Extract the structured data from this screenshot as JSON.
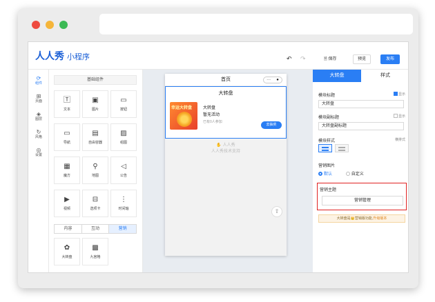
{
  "window": {
    "colors": {
      "close": "#ee4a3f",
      "minimize": "#f5b53a",
      "zoom": "#3cba55",
      "accent": "#2a7ef4",
      "highlight": "#e02020"
    }
  },
  "header": {
    "logo": "人人秀",
    "subtitle": "小程序",
    "save": "保存",
    "preview": "预览",
    "publish": "发布"
  },
  "leftnav": [
    {
      "icon": "component-icon",
      "label": "组件"
    },
    {
      "icon": "page-icon",
      "label": "页面"
    },
    {
      "icon": "layer-icon",
      "label": "图层"
    },
    {
      "icon": "style-icon",
      "label": "风格"
    },
    {
      "icon": "settings-icon",
      "label": "设置"
    }
  ],
  "components": {
    "section_title": "基础组件",
    "basic": [
      {
        "icon": "text-icon",
        "label": "文本"
      },
      {
        "icon": "image-icon",
        "label": "图片"
      },
      {
        "icon": "button-icon",
        "label": "按钮"
      },
      {
        "icon": "nav-icon",
        "label": "导航"
      },
      {
        "icon": "container-icon",
        "label": "自由容器"
      },
      {
        "icon": "gallery-icon",
        "label": "组图"
      },
      {
        "icon": "cube-icon",
        "label": "魔方"
      },
      {
        "icon": "map-icon",
        "label": "地图"
      },
      {
        "icon": "notice-icon",
        "label": "公告"
      },
      {
        "icon": "video-icon",
        "label": "视频"
      },
      {
        "icon": "tabs-icon",
        "label": "选项卡"
      },
      {
        "icon": "timeline-icon",
        "label": "时间轴"
      }
    ],
    "tabs": [
      "内容",
      "互动",
      "营销"
    ],
    "marketing": [
      {
        "icon": "wheel-icon",
        "label": "大转盘"
      },
      {
        "icon": "grid-icon",
        "label": "九宫格"
      }
    ]
  },
  "phone": {
    "title": "首页",
    "card": {
      "title": "大转盘",
      "thumb_text": "幸运大转盘",
      "name": "大转盘",
      "status": "暂无活动",
      "joined": "已有0人参加",
      "button": "去抽奖"
    },
    "support_logo": "人人秀",
    "support_text": "人人秀技术支持"
  },
  "panel": {
    "tabs": [
      "大转盘",
      "样式"
    ],
    "module_title_label": "模块标题",
    "module_title_show": "显示",
    "module_title_value": "大转盘",
    "module_subtitle_label": "模块副标题",
    "module_subtitle_show": "显示",
    "module_subtitle_value": "大转盘副标题",
    "module_style_label": "模块样式",
    "module_style_value": "横排式",
    "image_label": "营销图片",
    "image_opt_default": "默认",
    "image_opt_custom": "自定义",
    "theme_label": "营销主题",
    "theme_button": "营销管理",
    "upgrade_prefix": "大转盘是",
    "upgrade_mid": "营销版功能,",
    "upgrade_link": "升级版本"
  }
}
